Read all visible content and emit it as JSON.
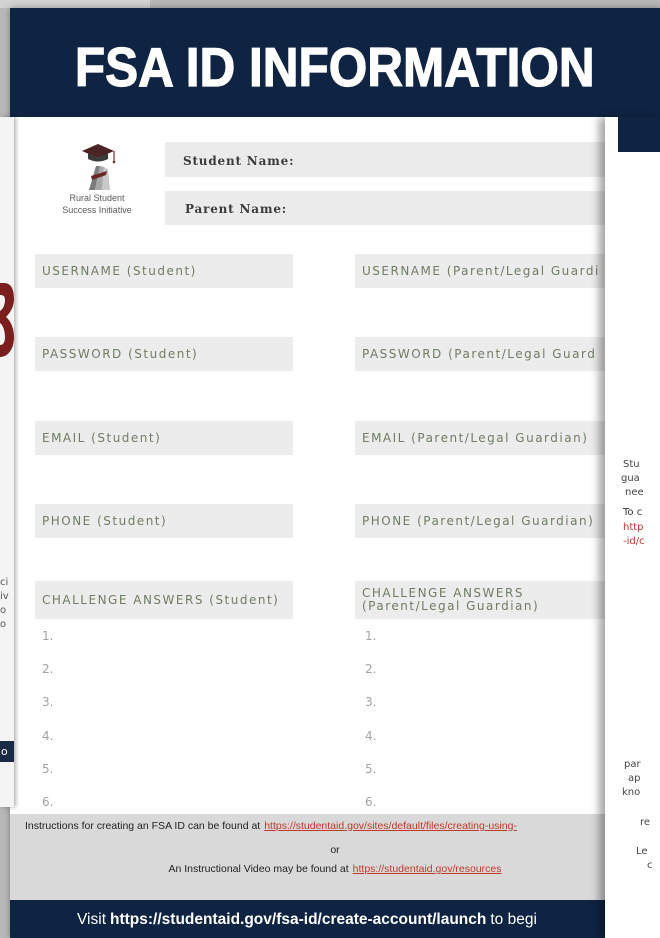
{
  "header": {
    "title": "FSA ID INFORMATION"
  },
  "logo": {
    "icon": "graduation-cap-icon",
    "line1": "Rural Student",
    "line2": "Success Initiative"
  },
  "names": {
    "student_label": "Student Name:",
    "parent_label": "Parent Name:"
  },
  "fields": [
    {
      "student": "USERNAME (Student)",
      "parent": "USERNAME (Parent/Legal Guardi"
    },
    {
      "student": "PASSWORD (Student)",
      "parent": "PASSWORD (Parent/Legal Guard"
    },
    {
      "student": "EMAIL (Student)",
      "parent": "EMAIL (Parent/Legal Guardian)"
    },
    {
      "student": "PHONE (Student)",
      "parent": "PHONE (Parent/Legal Guardian)"
    }
  ],
  "challenge": {
    "student": "CHALLENGE ANSWERS (Student)",
    "parent_line1": "CHALLENGE ANSWERS",
    "parent_line2": "(Parent/Legal Guardian)",
    "numbers": [
      "1.",
      "2.",
      "3.",
      "4.",
      "5.",
      "6."
    ]
  },
  "footer": {
    "instructions_prefix": "Instructions for creating an FSA ID can be found at",
    "instructions_link": "https://studentaid.gov/sites/default/files/creating-using-",
    "or": "or",
    "video_prefix": "An Instructional Video may be found at",
    "video_link": "https://studentaid.gov/resources"
  },
  "bottom_bar": {
    "prefix": "Visit",
    "link": "https://studentaid.gov/fsa-id/create-account/launch",
    "suffix": "to begi"
  },
  "side_left": {
    "lines": [
      "ci",
      "iv",
      "o",
      "o"
    ],
    "bar_text": "o"
  },
  "side_right": {
    "lines": [
      "Stu",
      "gua",
      "nee",
      "To c",
      "http",
      "-id/c",
      "par",
      "ap",
      "kno",
      "re",
      "Le",
      "c"
    ]
  },
  "colors": {
    "navy": "#0f2443",
    "field_fill": "#ececec",
    "field_text": "#6e7d63",
    "link": "#c0392b",
    "footer_band": "#d9d9d9",
    "accent_red": "#7a1e1e"
  }
}
